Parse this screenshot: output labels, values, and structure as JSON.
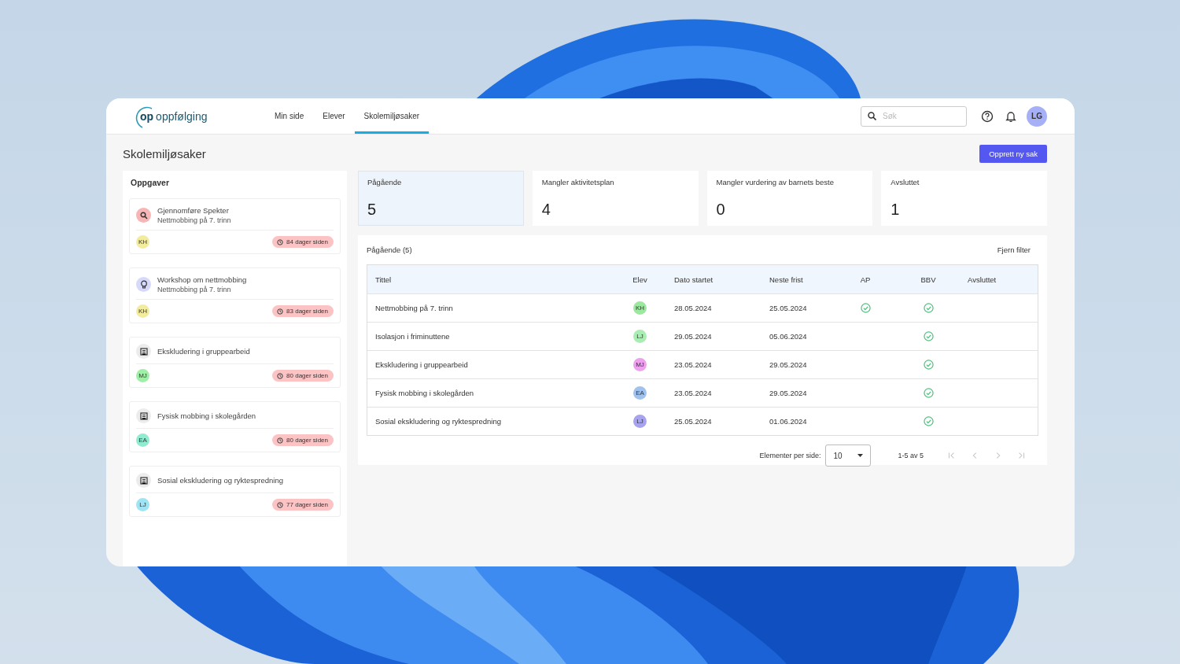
{
  "logo": {
    "mark": "op",
    "name": "oppfølging"
  },
  "nav": [
    {
      "label": "Min side",
      "selected": false
    },
    {
      "label": "Elever",
      "selected": false
    },
    {
      "label": "Skolemiljøsaker",
      "selected": true
    }
  ],
  "search": {
    "placeholder": "Søk"
  },
  "user": {
    "initials": "LG"
  },
  "page_title": "Skolemiljøsaker",
  "create_button": "Opprett ny sak",
  "tasks": {
    "title": "Oppgaver",
    "items": [
      {
        "kind": "search",
        "title": "Gjennomføre Spekter",
        "subtitle": "Nettmobbing på 7. trinn",
        "initials": "KH",
        "color": "#f3ec9c",
        "age": "84 dager siden"
      },
      {
        "kind": "idea",
        "title": "Workshop om nettmobbing",
        "subtitle": "Nettmobbing på 7. trinn",
        "initials": "KH",
        "color": "#f3ec9c",
        "age": "83 dager siden"
      },
      {
        "kind": "case",
        "title": "Ekskludering i gruppearbeid",
        "initials": "MJ",
        "color": "#9ff0a6",
        "age": "80 dager siden"
      },
      {
        "kind": "case",
        "title": "Fysisk mobbing i skolegården",
        "initials": "EA",
        "color": "#90ecd0",
        "age": "80 dager siden"
      },
      {
        "kind": "case",
        "title": "Sosial ekskludering og ryktespredning",
        "initials": "LJ",
        "color": "#9fe4f5",
        "age": "77 dager siden"
      }
    ]
  },
  "stats": [
    {
      "label": "Pågående",
      "value": "5",
      "selected": true
    },
    {
      "label": "Mangler aktivitetsplan",
      "value": "4",
      "selected": false
    },
    {
      "label": "Mangler vurdering av barnets beste",
      "value": "0",
      "selected": false
    },
    {
      "label": "Avsluttet",
      "value": "1",
      "selected": false
    }
  ],
  "cases": {
    "title": "Pågående (5)",
    "clear_filter": "Fjern filter",
    "columns": [
      "Tittel",
      "Elev",
      "Dato startet",
      "Neste frist",
      "AP",
      "BBV",
      "Avsluttet"
    ],
    "rows": [
      {
        "title": "Nettmobbing på 7. trinn",
        "initials": "KH",
        "color": "#9ce89f",
        "started": "28.05.2024",
        "deadline": "25.05.2024",
        "ap": true,
        "bbv": true
      },
      {
        "title": "Isolasjon i friminuttene",
        "initials": "LJ",
        "color": "#a8eeb2",
        "started": "29.05.2024",
        "deadline": "05.06.2024",
        "ap": false,
        "bbv": true
      },
      {
        "title": "Ekskludering i gruppearbeid",
        "initials": "MJ",
        "color": "#ee9ff0",
        "started": "23.05.2024",
        "deadline": "29.05.2024",
        "ap": false,
        "bbv": true
      },
      {
        "title": "Fysisk mobbing i skolegården",
        "initials": "EA",
        "color": "#9fc3ee",
        "started": "23.05.2024",
        "deadline": "29.05.2024",
        "ap": false,
        "bbv": true
      },
      {
        "title": "Sosial ekskludering og ryktespredning",
        "initials": "LJ",
        "color": "#a8a3ee",
        "started": "25.05.2024",
        "deadline": "01.06.2024",
        "ap": false,
        "bbv": true
      }
    ],
    "pagination": {
      "label": "Elementer per side:",
      "page_size": "10",
      "range": "1-5 av 5",
      "buttons": [
        {
          "kind": "first",
          "disabled": true
        },
        {
          "kind": "prev",
          "disabled": true
        },
        {
          "kind": "next",
          "disabled": true
        },
        {
          "kind": "last",
          "disabled": true
        }
      ]
    }
  }
}
